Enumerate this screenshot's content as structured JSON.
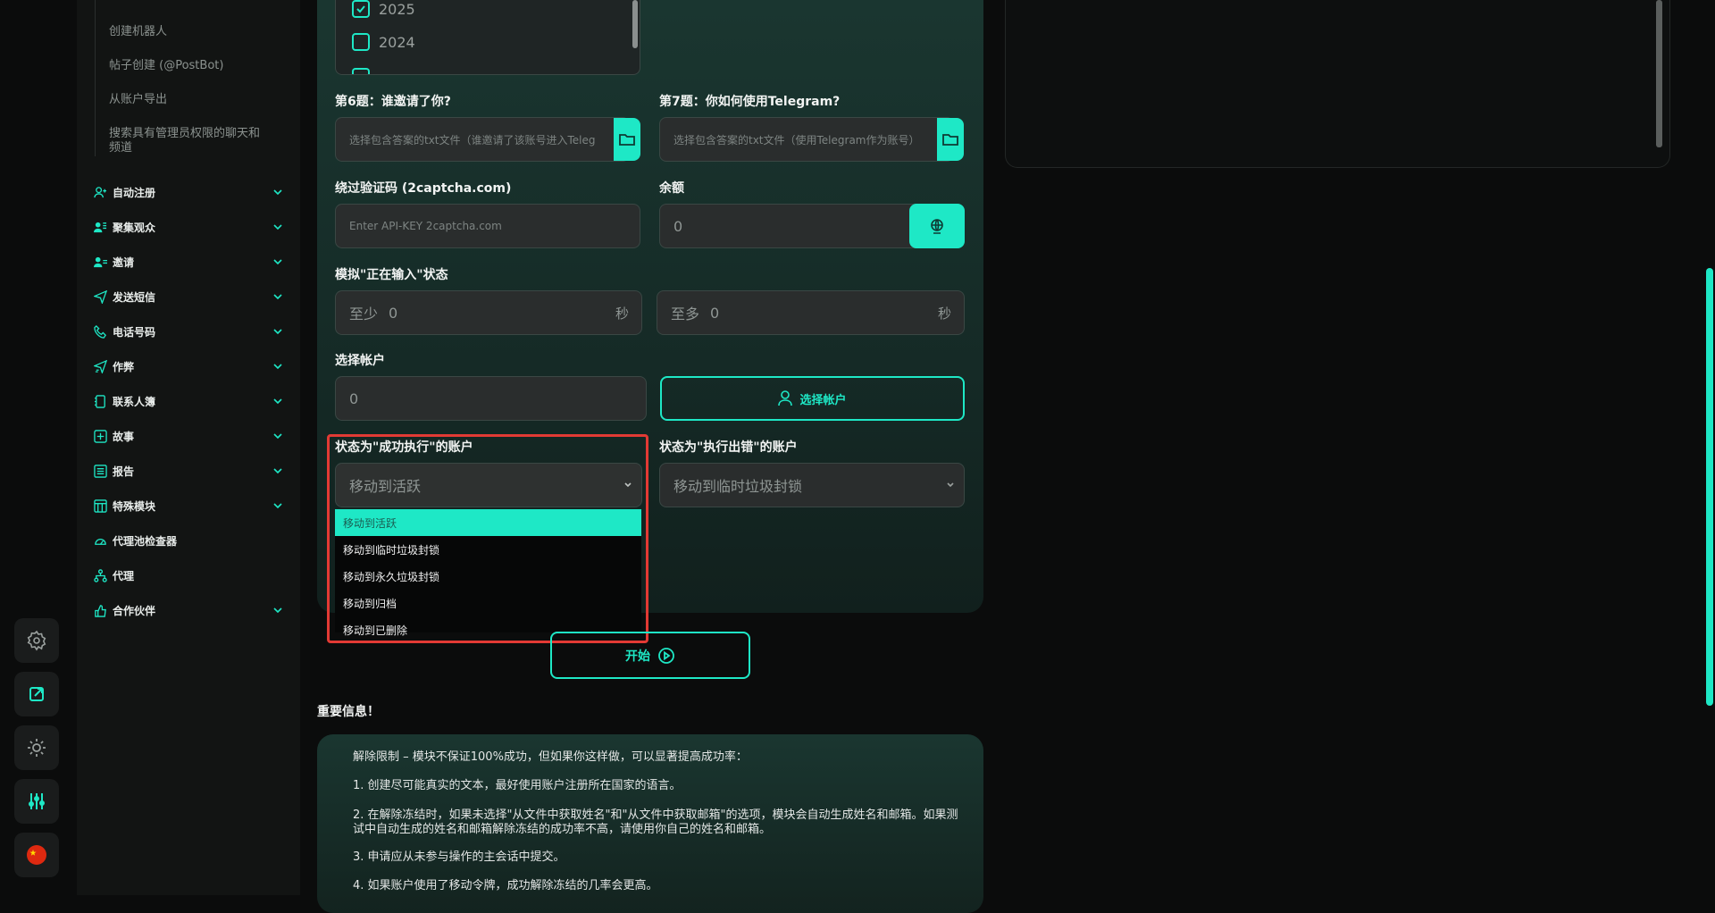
{
  "sidebar": {
    "sub_items": [
      {
        "label": "创建机器人"
      },
      {
        "label": "帖子创建 (@PostBot)"
      },
      {
        "label": "从账户导出"
      },
      {
        "label": "搜索具有管理员权限的聊天和频道"
      }
    ],
    "items": [
      {
        "label": "自动注册",
        "icon": "user-add-icon"
      },
      {
        "label": "聚集观众",
        "icon": "users-icon"
      },
      {
        "label": "邀请",
        "icon": "invite-icon"
      },
      {
        "label": "发送短信",
        "icon": "send-icon"
      },
      {
        "label": "电话号码",
        "icon": "phone-icon"
      },
      {
        "label": "作弊",
        "icon": "cheat-icon"
      },
      {
        "label": "联系人簿",
        "icon": "contacts-icon"
      },
      {
        "label": "故事",
        "icon": "story-icon"
      },
      {
        "label": "报告",
        "icon": "report-icon"
      },
      {
        "label": "特殊模块",
        "icon": "special-icon"
      },
      {
        "label": "代理池检查器",
        "icon": "gauge-icon"
      },
      {
        "label": "代理",
        "icon": "proxy-icon"
      },
      {
        "label": "合作伙伴",
        "icon": "partner-icon"
      }
    ]
  },
  "rail": [
    {
      "icon": "gear-icon"
    },
    {
      "icon": "external-link-icon"
    },
    {
      "icon": "sun-icon"
    },
    {
      "icon": "sliders-icon"
    },
    {
      "icon": "china-flag-icon"
    }
  ],
  "years": [
    {
      "label": "2025",
      "checked": true
    },
    {
      "label": "2024",
      "checked": false
    }
  ],
  "q6": {
    "label": "第6题：谁邀请了你?",
    "placeholder": "选择包含答案的txt文件（谁邀请了该账号进入Teleg"
  },
  "q7": {
    "label": "第7题：你如何使用Telegram?",
    "placeholder": "选择包含答案的txt文件（使用Telegram作为账号）"
  },
  "captcha": {
    "label": "绕过验证码 (2captcha.com)",
    "placeholder": "Enter API-KEY 2captcha.com"
  },
  "balance": {
    "label": "余额",
    "value": "0"
  },
  "typing": {
    "label": "模拟\"正在输入\"状态",
    "min_prefix": "至少",
    "min_value": "0",
    "min_unit": "秒",
    "max_prefix": "至多",
    "max_value": "0",
    "max_unit": "秒"
  },
  "accounts": {
    "label": "选择帐户",
    "value": "0",
    "button": "选择帐户"
  },
  "success": {
    "label": "状态为\"成功执行\"的账户",
    "selected": "移动到活跃",
    "options": [
      "移动到活跃",
      "移动到临时垃圾封锁",
      "移动到永久垃圾封锁",
      "移动到归档",
      "移动到已删除"
    ]
  },
  "error": {
    "label": "状态为\"执行出错\"的账户",
    "selected": "移动到临时垃圾封锁"
  },
  "start_button": "开始",
  "info": {
    "heading": "重要信息！",
    "paragraphs": [
      "解除限制 – 模块不保证100%成功，但如果你这样做，可以显著提高成功率：",
      "1. 创建尽可能真实的文本，最好使用账户注册所在国家的语言。",
      "2. 在解除冻结时，如果未选择\"从文件中获取姓名\"和\"从文件中获取邮箱\"的选项，模块会自动生成姓名和邮箱。如果测试中自动生成的姓名和邮箱解除冻结的成功率不高，请使用你自己的姓名和邮箱。",
      "3. 申请应从未参与操作的主会话中提交。",
      "4. 如果账户使用了移动令牌，成功解除冻结的几率会更高。"
    ]
  },
  "colors": {
    "accent": "#1ee8c6",
    "highlight": "#e23a34",
    "card": "#1a3630"
  }
}
